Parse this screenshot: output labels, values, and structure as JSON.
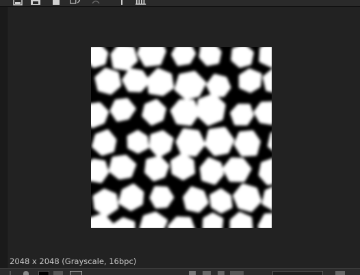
{
  "viewer": {
    "info": "2048 x 2048 (Grayscale, 16bpc)"
  },
  "toolbar": {
    "icons": [
      "frame-icon",
      "save-icon",
      "square-icon",
      "export-icon",
      "undo-icon",
      "pin-icon",
      "histogram-icon"
    ]
  },
  "colors": {
    "background": "#232323",
    "texture_black": "#000000",
    "texture_white": "#ffffff"
  }
}
